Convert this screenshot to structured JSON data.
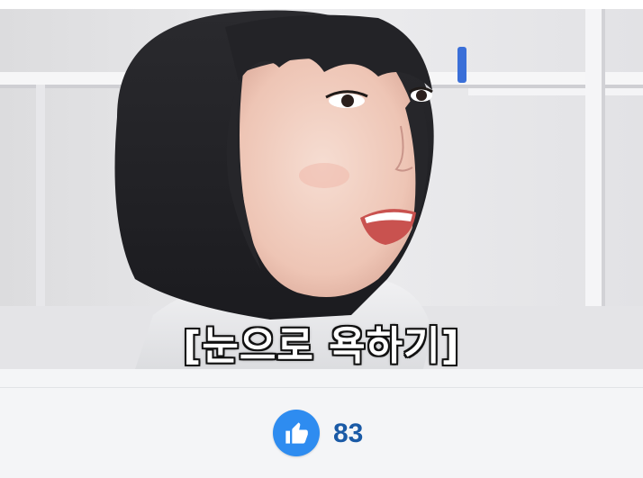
{
  "video": {
    "subtitle": "[눈으로 욕하기]",
    "image_subject": "girl-with-bob-haircut"
  },
  "reactions": {
    "like_icon": "thumbs-up-icon",
    "like_count": "83",
    "accent_color": "#2e8cf0",
    "count_color": "#1a5aa6"
  }
}
